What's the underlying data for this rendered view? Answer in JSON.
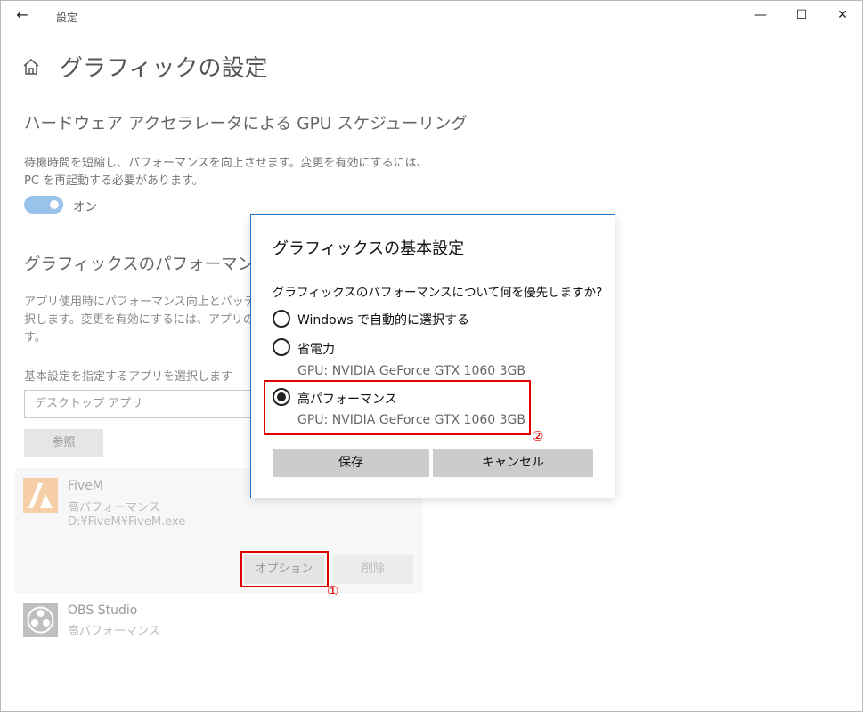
{
  "window": {
    "title": "設定",
    "back_icon": "←",
    "minimize_icon": "—",
    "maximize_icon": "☐",
    "close_icon": "✕"
  },
  "page": {
    "title": "グラフィックの設定"
  },
  "gpu_scheduling": {
    "heading": "ハードウェア アクセラレータによる GPU スケジューリング",
    "description_line1": "待機時間を短縮し、パフォーマンスを向上させます。変更を有効にするには、",
    "description_line2": "PC を再起動する必要があります。",
    "toggle_state": "オン",
    "toggle_color": "#99c3ea"
  },
  "performance_settings": {
    "heading": "グラフィックスのパフォーマンスの基本設定",
    "description_line1": "アプリ使用時にパフォーマンス向上とバッテリー寿命のどちらを優先するかを選",
    "description_line2": "択します。変更を有効にするには、アプリの再起動が必要になる場合がありま",
    "description_line3": "す。",
    "select_label": "基本設定を指定するアプリを選択します",
    "select_value": "デスクトップ アプリ",
    "browse_label": "参照"
  },
  "apps": [
    {
      "name": "FiveM",
      "preference": "高パフォーマンス",
      "path": "D:¥FiveM¥FiveM.exe",
      "options_label": "オプション",
      "delete_label": "削除",
      "marker": "①"
    },
    {
      "name": "OBS Studio",
      "preference": "高パフォーマンス"
    }
  ],
  "dialog": {
    "title": "グラフィックスの基本設定",
    "question": "グラフィックスのパフォーマンスについて何を優先しますか?",
    "options": [
      {
        "label": "Windows で自動的に選択する",
        "checked": false
      },
      {
        "label": "省電力",
        "gpu": "GPU: NVIDIA GeForce GTX 1060 3GB",
        "checked": false
      },
      {
        "label": "高パフォーマンス",
        "gpu": "GPU: NVIDIA GeForce GTX 1060 3GB",
        "checked": true
      }
    ],
    "marker": "②",
    "save_label": "保存",
    "cancel_label": "キャンセル",
    "border_color": "#1d78c8",
    "highlight_color": "#e00000"
  }
}
